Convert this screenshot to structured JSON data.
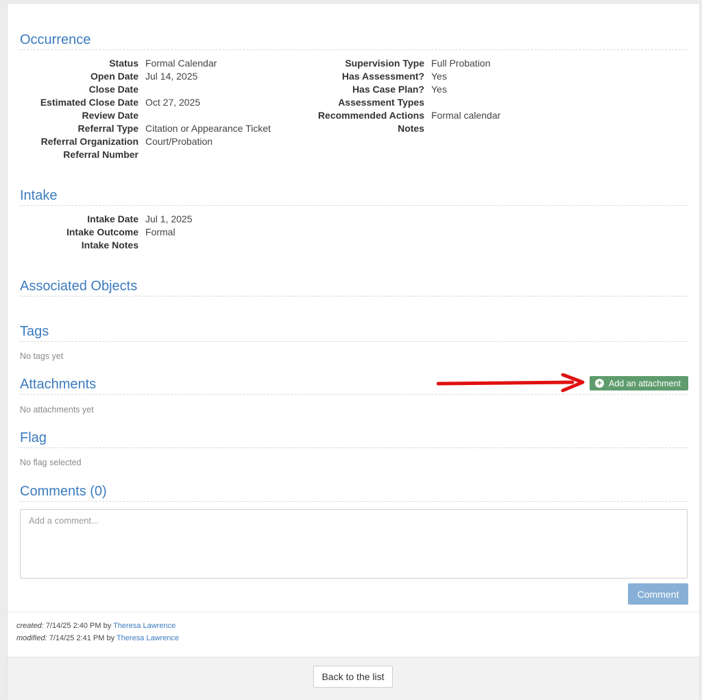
{
  "occurrence": {
    "title": "Occurrence",
    "left": [
      {
        "label": "Status",
        "value": "Formal Calendar"
      },
      {
        "label": "Open Date",
        "value": "Jul 14, 2025"
      },
      {
        "label": "Close Date",
        "value": ""
      },
      {
        "label": "Estimated Close Date",
        "value": "Oct 27, 2025"
      },
      {
        "label": "Review Date",
        "value": ""
      },
      {
        "label": "Referral Type",
        "value": "Citation or Appearance Ticket"
      },
      {
        "label": "Referral Organization",
        "value": "Court/Probation"
      },
      {
        "label": "Referral Number",
        "value": ""
      }
    ],
    "right": [
      {
        "label": "Supervision Type",
        "value": "Full Probation"
      },
      {
        "label": "Has Assessment?",
        "value": "Yes"
      },
      {
        "label": "Has Case Plan?",
        "value": "Yes"
      },
      {
        "label": "Assessment Types",
        "value": ""
      },
      {
        "label": "Recommended Actions",
        "value": "Formal calendar"
      },
      {
        "label": "Notes",
        "value": ""
      }
    ]
  },
  "intake": {
    "title": "Intake",
    "fields": [
      {
        "label": "Intake Date",
        "value": "Jul 1, 2025"
      },
      {
        "label": "Intake Outcome",
        "value": "Formal"
      },
      {
        "label": "Intake Notes",
        "value": ""
      }
    ]
  },
  "associated": {
    "title": "Associated Objects"
  },
  "tags": {
    "title": "Tags",
    "empty": "No tags yet"
  },
  "attachments": {
    "title": "Attachments",
    "empty": "No attachments yet",
    "add_label": "Add an attachment"
  },
  "flag": {
    "title": "Flag",
    "empty": "No flag selected"
  },
  "comments": {
    "title": "Comments (0)",
    "placeholder": "Add a comment...",
    "button": "Comment"
  },
  "meta": {
    "created_label": "created:",
    "created_value": "7/14/25 2:40 PM by",
    "created_user": "Theresa Lawrence",
    "modified_label": "modified:",
    "modified_value": "7/14/25 2:41 PM by",
    "modified_user": "Theresa Lawrence"
  },
  "footer": {
    "back_label": "Back to the list"
  },
  "colors": {
    "accent": "#3b7bbf",
    "attach_button": "#5f9c6d",
    "comment_button": "#88b0d6",
    "arrow": "#e01010"
  }
}
